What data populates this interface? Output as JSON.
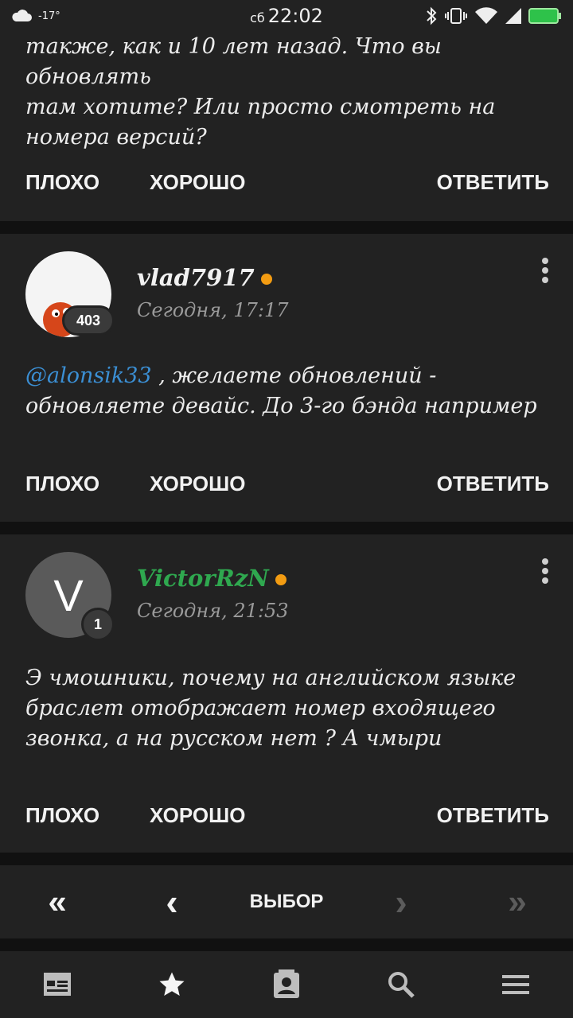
{
  "status_bar": {
    "temperature": "-17°",
    "day": "сб",
    "time": "22:02"
  },
  "top_card": {
    "text_lines": [
      "также, как и 10 лет назад. Что вы обновлять",
      "там хотите? Или просто смотреть на",
      "номера версий?"
    ]
  },
  "actions": {
    "bad": "ПЛОХО",
    "good": "ХОРОШО",
    "reply": "ОТВЕТИТЬ"
  },
  "comments": [
    {
      "username": "vlad7917",
      "username_color": "#f2f2f2",
      "time": "Сегодня, 17:17",
      "badge": "403",
      "mention": "@alonsik33",
      "text_lines": [
        ", желаете обновлений -",
        "обновляете девайс. До 3-го бэнда например"
      ]
    },
    {
      "username": "VictorRzN",
      "username_color": "#2fa84f",
      "avatar_letter": "V",
      "time": "Сегодня, 21:53",
      "badge": "1",
      "text_lines": [
        "Э чмошники, почему на английском языке",
        "браслет отображает номер входящего",
        "звонка, а на русском нет ? А чмыри"
      ]
    }
  ],
  "pager": {
    "first": "«",
    "prev": "‹",
    "label": "ВЫБОР",
    "next": "›",
    "last": "»"
  },
  "bottom_nav": [
    "news-icon",
    "favorites-star-icon",
    "contacts-icon",
    "search-icon",
    "menu-icon"
  ]
}
